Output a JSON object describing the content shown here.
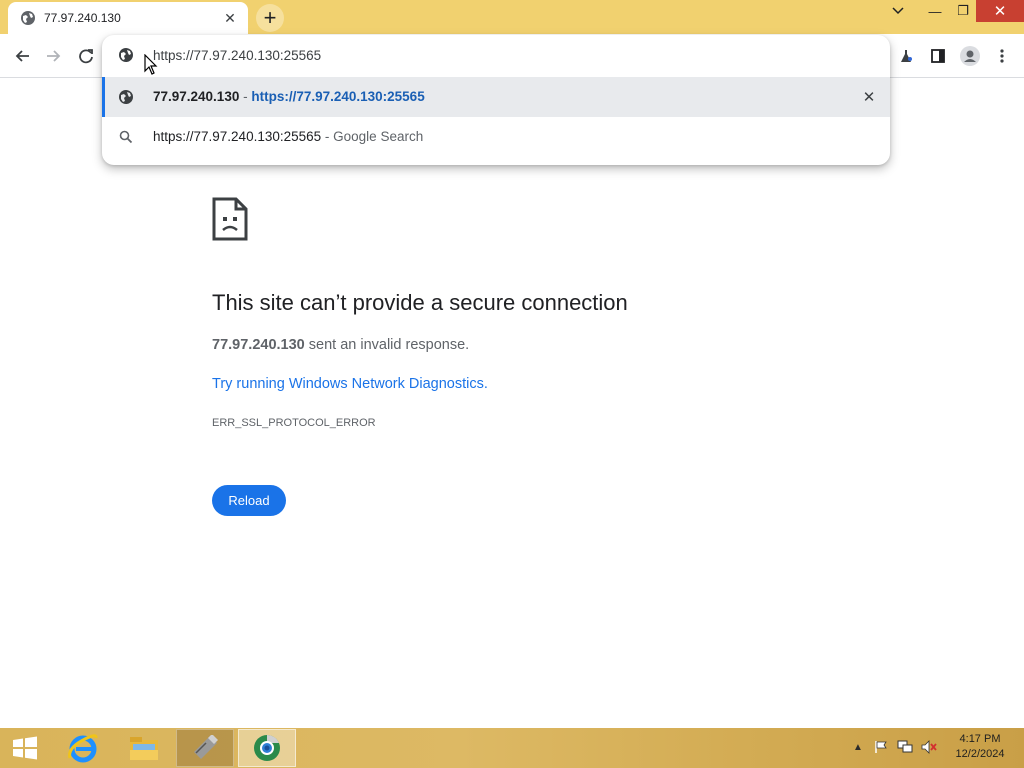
{
  "browser": {
    "tab": {
      "title": "77.97.240.130",
      "icon": "globe-icon"
    },
    "window_controls": {
      "minimize": "—",
      "maximize": "❐",
      "close": "✕"
    },
    "omnibox": {
      "value": "https://77.97.240.130:25565",
      "suggestions": [
        {
          "icon": "globe-icon",
          "title": "77.97.240.130",
          "separator": " - ",
          "url": "https://77.97.240.130:25565",
          "removable": true
        },
        {
          "icon": "search-icon",
          "query": "https://77.97.240.130:25565",
          "separator": " - ",
          "description": "Google Search"
        }
      ]
    }
  },
  "error_page": {
    "title": "This site can’t provide a secure connection",
    "host": "77.97.240.130",
    "message": " sent an invalid response.",
    "link": "Try running Windows Network Diagnostics.",
    "code": "ERR_SSL_PROTOCOL_ERROR",
    "reload_label": "Reload"
  },
  "taskbar": {
    "apps": [
      "start-icon",
      "internet-explorer-icon",
      "file-explorer-icon",
      "usb-drive-icon",
      "chrome-app-icon"
    ],
    "clock": {
      "time": "4:17 PM",
      "date": "12/2/2024"
    }
  },
  "colors": {
    "titlebar": "#f1d16f",
    "accent_blue": "#1a73e8",
    "close_red": "#c84031"
  }
}
